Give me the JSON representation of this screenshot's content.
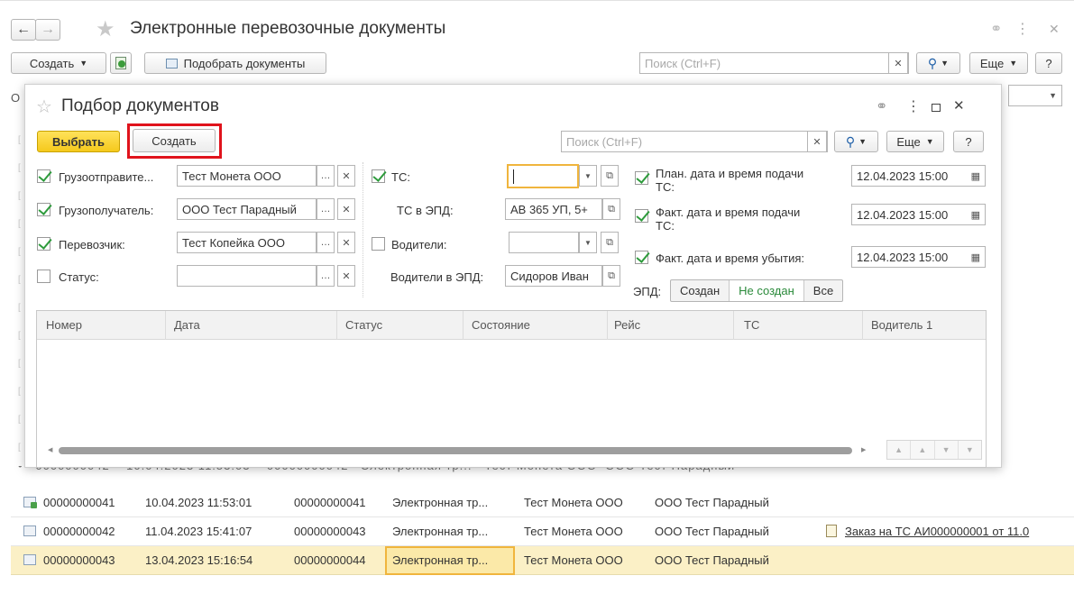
{
  "window": {
    "title": "Электронные перевозочные документы",
    "create_label": "Создать",
    "pick_docs_label": "Подобрать документы",
    "search_placeholder": "Поиск (Ctrl+F)",
    "more_label": "Еще",
    "help_label": "?",
    "partial_label": "О"
  },
  "dialog": {
    "title": "Подбор документов",
    "select_label": "Выбрать",
    "create_label": "Создать",
    "search_placeholder": "Поиск (Ctrl+F)",
    "more_label": "Еще",
    "help_label": "?",
    "filters": {
      "shipper_label": "Грузоотправите...",
      "shipper_value": "Тест Монета ООО",
      "consignee_label": "Грузополучатель:",
      "consignee_value": "ООО Тест Парадный",
      "carrier_label": "Перевозчик:",
      "carrier_value": "Тест Копейка ООО",
      "status_label": "Статус:",
      "status_value": "",
      "ts_label": "ТС:",
      "ts_value": "",
      "ts_epd_label": "ТС в ЭПД:",
      "ts_epd_value": "АВ 365 УП, 5+",
      "drivers_label": "Водители:",
      "drivers_value": "",
      "drivers_epd_label": "Водители в ЭПД:",
      "drivers_epd_value": "Сидоров Иван",
      "plan_date_label_1": "План. дата и время подачи",
      "plan_date_label_2": "ТС:",
      "plan_date_value": "12.04.2023 15:00",
      "fact_date_label_1": "Факт. дата и время подачи",
      "fact_date_label_2": "ТС:",
      "fact_date_value": "12.04.2023 15:00",
      "depart_label": "Факт. дата и время убытия:",
      "depart_value": "12.04.2023 15:00",
      "epd_label": "ЭПД:",
      "epd_options": [
        "Создан",
        "Не создан",
        "Все"
      ]
    },
    "columns": [
      "Номер",
      "Дата",
      "Статус",
      "Состояние",
      "Рейс",
      "ТС",
      "Водитель 1"
    ]
  },
  "list": {
    "rows": [
      {
        "num": "00000000041",
        "date": "10.04.2023 11:53:01",
        "doc": "00000000041",
        "type": "Электронная тр...",
        "shipper": "Тест Монета ООО",
        "consignee": "ООО Тест Парадный",
        "link": ""
      },
      {
        "num": "00000000042",
        "date": "11.04.2023 15:41:07",
        "doc": "00000000043",
        "type": "Электронная тр...",
        "shipper": "Тест Монета ООО",
        "consignee": "ООО Тест Парадный",
        "link": "Заказ на ТС АИ000000001 от 11.0"
      },
      {
        "num": "00000000043",
        "date": "13.04.2023 15:16:54",
        "doc": "00000000044",
        "type": "Электронная тр...",
        "shipper": "Тест Монета ООО",
        "consignee": "ООО Тест Парадный",
        "link": ""
      }
    ]
  }
}
